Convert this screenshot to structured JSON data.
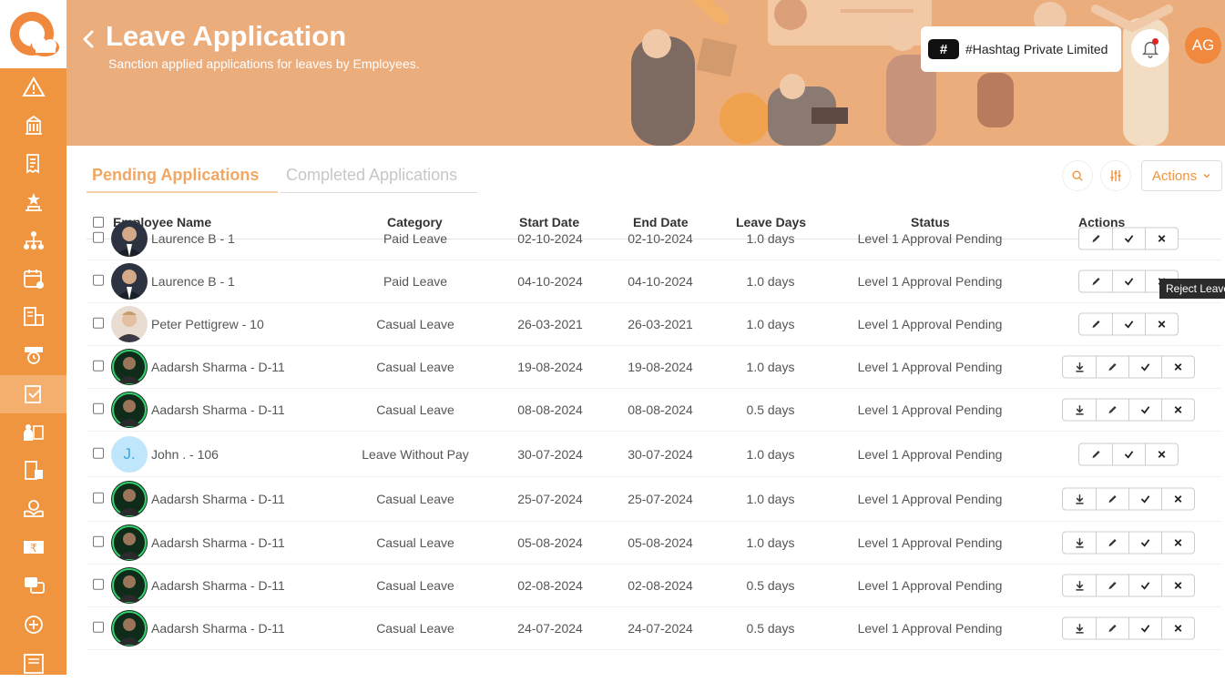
{
  "header": {
    "title": "Leave Application",
    "subtitle": "Sanction applied applications for leaves by Employees.",
    "company": {
      "badge": "#",
      "name": "#Hashtag Private Limited"
    },
    "user_initials": "AG"
  },
  "tabs": [
    {
      "label": "Pending Applications",
      "active": true
    },
    {
      "label": "Completed Applications",
      "active": false
    }
  ],
  "toolbar": {
    "actions_label": "Actions"
  },
  "table": {
    "columns": [
      "Employee Name",
      "Category",
      "Start Date",
      "End Date",
      "Leave Days",
      "Status",
      "Actions"
    ],
    "rows": [
      {
        "name": "Laurence B - 1",
        "category": "Paid Leave",
        "start": "02-10-2024",
        "end": "02-10-2024",
        "days": "1.0 days",
        "status": "Level 1 Approval Pending",
        "avatar": "photo-suit",
        "download": false
      },
      {
        "name": "Laurence B - 1",
        "category": "Paid Leave",
        "start": "04-10-2024",
        "end": "04-10-2024",
        "days": "1.0 days",
        "status": "Level 1 Approval Pending",
        "avatar": "photo-suit",
        "download": false
      },
      {
        "name": "Peter Pettigrew - 10",
        "category": "Casual Leave",
        "start": "26-03-2021",
        "end": "26-03-2021",
        "days": "1.0 days",
        "status": "Level 1 Approval Pending",
        "avatar": "photo-light",
        "download": false
      },
      {
        "name": "Aadarsh Sharma - D-11",
        "category": "Casual Leave",
        "start": "19-08-2024",
        "end": "19-08-2024",
        "days": "1.0 days",
        "status": "Level 1 Approval Pending",
        "avatar": "photo-green",
        "download": true
      },
      {
        "name": "Aadarsh Sharma - D-11",
        "category": "Casual Leave",
        "start": "08-08-2024",
        "end": "08-08-2024",
        "days": "0.5 days",
        "status": "Level 1 Approval Pending",
        "avatar": "photo-green",
        "download": true
      },
      {
        "name": "John . - 106",
        "category": "Leave Without Pay",
        "start": "30-07-2024",
        "end": "30-07-2024",
        "days": "1.0 days",
        "status": "Level 1 Approval Pending",
        "avatar": "initial",
        "initial": "J.",
        "download": false
      },
      {
        "name": "Aadarsh Sharma - D-11",
        "category": "Casual Leave",
        "start": "25-07-2024",
        "end": "25-07-2024",
        "days": "1.0 days",
        "status": "Level 1 Approval Pending",
        "avatar": "photo-green",
        "download": true
      },
      {
        "name": "Aadarsh Sharma - D-11",
        "category": "Casual Leave",
        "start": "05-08-2024",
        "end": "05-08-2024",
        "days": "1.0 days",
        "status": "Level 1 Approval Pending",
        "avatar": "photo-green",
        "download": true
      },
      {
        "name": "Aadarsh Sharma - D-11",
        "category": "Casual Leave",
        "start": "02-08-2024",
        "end": "02-08-2024",
        "days": "0.5 days",
        "status": "Level 1 Approval Pending",
        "avatar": "photo-green",
        "download": true
      },
      {
        "name": "Aadarsh Sharma - D-11",
        "category": "Casual Leave",
        "start": "24-07-2024",
        "end": "24-07-2024",
        "days": "0.5 days",
        "status": "Level 1 Approval Pending",
        "avatar": "photo-green",
        "download": true
      }
    ]
  },
  "tooltip": "Reject Leave",
  "sidebar": {
    "items": [
      "alert-icon",
      "building-icon",
      "receipt-icon",
      "award-icon",
      "org-chart-icon",
      "calendar-check-icon",
      "report-icon",
      "clock-calendar-icon",
      "leave-icon",
      "expense-icon",
      "documents-icon",
      "helpdesk-icon",
      "payroll-icon",
      "chat-icon",
      "training-icon",
      "news-icon"
    ],
    "active_index": 8
  },
  "colors": {
    "accent": "#f0953f",
    "banner": "#ecad7d",
    "tab_active": "#f0a764"
  }
}
